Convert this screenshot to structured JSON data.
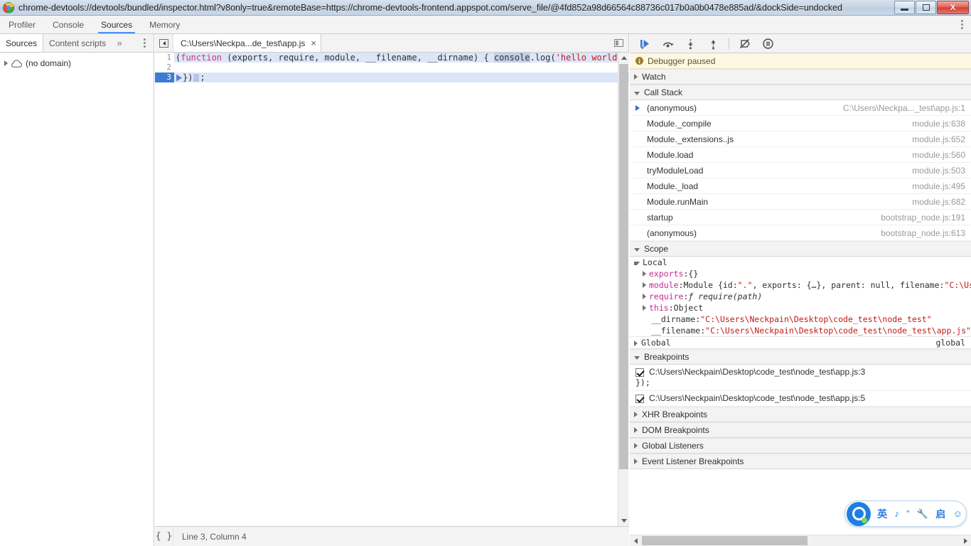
{
  "window": {
    "title": "chrome-devtools://devtools/bundled/inspector.html?v8only=true&remoteBase=https://chrome-devtools-frontend.appspot.com/serve_file/@4fd852a98d66564c88736c017b0a0b0478e885ad/&dockSide=undocked",
    "favicon_icon": "chrome-logo-icon",
    "buttons": {
      "minimize": "minimize-icon",
      "maximize": "maximize-restore-icon",
      "close": "X"
    }
  },
  "devtools_tabs": [
    {
      "label": "Profiler",
      "active": false
    },
    {
      "label": "Console",
      "active": false
    },
    {
      "label": "Sources",
      "active": true
    },
    {
      "label": "Memory",
      "active": false
    }
  ],
  "devtools_more_icon": "kebab-menu-icon",
  "navigator": {
    "tabs": [
      {
        "label": "Sources",
        "active": true
      },
      {
        "label": "Content scripts",
        "active": false
      }
    ],
    "overflow_label": "»",
    "menu_icon": "kebab-menu-icon",
    "tree": [
      {
        "label": "(no domain)",
        "icon": "cloud-icon",
        "expanded": false
      }
    ]
  },
  "editor": {
    "collapse_icon": "collapse-sidebar-icon",
    "tab": {
      "label": "C:\\Users\\Neckpa...de_test\\app.js",
      "close_label": "×"
    },
    "right_icon": "show-navigator-icon",
    "code": {
      "lines": [
        {
          "number": "1",
          "executing": false,
          "tokens": [
            {
              "text": "(",
              "cls": "tok-punct"
            },
            {
              "text": "function",
              "cls": "tok-kw"
            },
            {
              "text": " (exports, require, module, __filename, __dirname) { ",
              "cls": "tok-plain"
            },
            {
              "text": "console",
              "cls": "tok-obj"
            },
            {
              "text": ".log(",
              "cls": "tok-plain"
            },
            {
              "text": "'hello world'",
              "cls": "tok-str"
            },
            {
              "text": ")",
              "cls": "tok-plain"
            }
          ]
        },
        {
          "number": "2",
          "executing": false,
          "tokens": []
        },
        {
          "number": "3",
          "executing": true,
          "tokens": [
            {
              "text": "})",
              "cls": "tok-plain"
            },
            {
              "text": ";",
              "cls": "tok-plain"
            }
          ]
        }
      ]
    },
    "status": {
      "pretty_print_label": "{ }",
      "cursor_position": "Line 3, Column 4"
    }
  },
  "debugger": {
    "toolbar": [
      {
        "name": "resume-script-execution-button",
        "icon": "resume-icon"
      },
      {
        "name": "step-over-button",
        "icon": "step-over-icon"
      },
      {
        "name": "step-into-button",
        "icon": "step-into-icon"
      },
      {
        "name": "step-out-button",
        "icon": "step-out-icon"
      },
      {
        "name": "deactivate-breakpoints-button",
        "icon": "deactivate-breakpoints-icon"
      },
      {
        "name": "pause-on-exceptions-button",
        "icon": "pause-on-exceptions-icon"
      }
    ],
    "paused_banner": {
      "icon": "info-icon",
      "text": "Debugger paused"
    },
    "watch": {
      "label": "Watch",
      "expanded": false
    },
    "call_stack": {
      "label": "Call Stack",
      "expanded": true,
      "frames": [
        {
          "function": "(anonymous)",
          "location": "C:\\Users\\Neckpa..._test\\app.js:1",
          "selected": true
        },
        {
          "function": "Module._compile",
          "location": "module.js:638",
          "selected": false
        },
        {
          "function": "Module._extensions..js",
          "location": "module.js:652",
          "selected": false
        },
        {
          "function": "Module.load",
          "location": "module.js:560",
          "selected": false
        },
        {
          "function": "tryModuleLoad",
          "location": "module.js:503",
          "selected": false
        },
        {
          "function": "Module._load",
          "location": "module.js:495",
          "selected": false
        },
        {
          "function": "Module.runMain",
          "location": "module.js:682",
          "selected": false
        },
        {
          "function": "startup",
          "location": "bootstrap_node.js:191",
          "selected": false
        },
        {
          "function": "(anonymous)",
          "location": "bootstrap_node.js:613",
          "selected": false
        }
      ]
    },
    "scope": {
      "label": "Scope",
      "expanded": true,
      "local_label": "Local",
      "properties": [
        {
          "expandable": true,
          "indent": 1,
          "parts": [
            {
              "text": "exports",
              "cls": "sc-prop"
            },
            {
              "text": ": ",
              "cls": "sc-muted"
            },
            {
              "text": "{}",
              "cls": "sc-name"
            }
          ]
        },
        {
          "expandable": true,
          "indent": 1,
          "parts": [
            {
              "text": "module",
              "cls": "sc-prop"
            },
            {
              "text": ": ",
              "cls": "sc-muted"
            },
            {
              "text": "Module {id: ",
              "cls": "sc-name"
            },
            {
              "text": "\".\"",
              "cls": "sc-str"
            },
            {
              "text": ", exports: {…}, parent: null, filename: ",
              "cls": "sc-name"
            },
            {
              "text": "\"C:\\Us",
              "cls": "sc-str"
            }
          ]
        },
        {
          "expandable": true,
          "indent": 1,
          "parts": [
            {
              "text": "require",
              "cls": "sc-prop"
            },
            {
              "text": ": ",
              "cls": "sc-muted"
            },
            {
              "text": "ƒ require(path)",
              "cls": "sc-fn"
            }
          ]
        },
        {
          "expandable": true,
          "indent": 1,
          "parts": [
            {
              "text": "this",
              "cls": "sc-prop"
            },
            {
              "text": ": ",
              "cls": "sc-muted"
            },
            {
              "text": "Object",
              "cls": "sc-name"
            }
          ]
        },
        {
          "expandable": false,
          "indent": 2,
          "parts": [
            {
              "text": "__dirname",
              "cls": "sc-name"
            },
            {
              "text": ": ",
              "cls": "sc-muted"
            },
            {
              "text": "\"C:\\Users\\Neckpain\\Desktop\\code_test\\node_test\"",
              "cls": "sc-str"
            }
          ]
        },
        {
          "expandable": false,
          "indent": 2,
          "parts": [
            {
              "text": "__filename",
              "cls": "sc-name"
            },
            {
              "text": ": ",
              "cls": "sc-muted"
            },
            {
              "text": "\"C:\\Users\\Neckpain\\Desktop\\code_test\\node_test\\app.js\"",
              "cls": "sc-str"
            }
          ]
        }
      ],
      "global": {
        "label": "Global",
        "value": "global",
        "expanded": false
      }
    },
    "breakpoints": {
      "label": "Breakpoints",
      "expanded": true,
      "items": [
        {
          "checked": true,
          "location": "C:\\Users\\Neckpain\\Desktop\\code_test\\node_test\\app.js:3",
          "snippet": "});"
        },
        {
          "checked": true,
          "location": "C:\\Users\\Neckpain\\Desktop\\code_test\\node_test\\app.js:5",
          "snippet": ""
        }
      ]
    },
    "collapsed_sections": [
      {
        "label": "XHR Breakpoints"
      },
      {
        "label": "DOM Breakpoints"
      },
      {
        "label": "Global Listeners"
      },
      {
        "label": "Event Listener Breakpoints"
      }
    ]
  },
  "ime": {
    "logo_icon": "qq-pinyin-logo-icon",
    "items": [
      {
        "label": "英",
        "name": "ime-language-mode",
        "kind": "text"
      },
      {
        "label": "♪",
        "name": "ime-moon-icon",
        "kind": "icon"
      },
      {
        "label": "”",
        "name": "ime-punctuation-icon",
        "kind": "icon"
      },
      {
        "label": "🔧",
        "name": "ime-toolbox-icon",
        "kind": "icon"
      },
      {
        "label": "启",
        "name": "ime-start-icon",
        "kind": "text"
      },
      {
        "label": "☺",
        "name": "ime-smiley-icon",
        "kind": "icon"
      }
    ]
  },
  "colors": {
    "accent": "#4a8df8",
    "paused_banner_bg": "#fdf8e3",
    "exec_line_bg": "#dde6f8",
    "gutter_exec_bg": "#3d7bd6",
    "string_token": "#c41a16",
    "keyword_token": "#d6317a",
    "property_token": "#c02c91"
  }
}
